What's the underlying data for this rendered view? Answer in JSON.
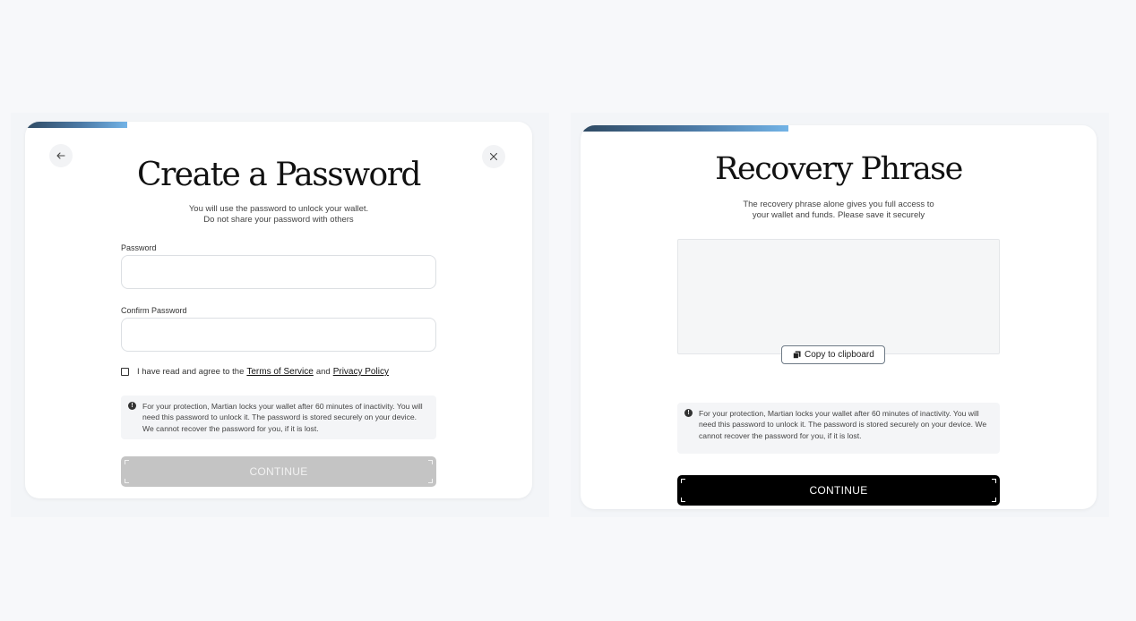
{
  "create_password": {
    "title": "Create a Password",
    "subtitle_line1": "You will use the password to unlock your wallet.",
    "subtitle_line2": "Do not share your password with others",
    "progress": 0.2,
    "password_label": "Password",
    "password_value": "",
    "confirm_label": "Confirm Password",
    "confirm_value": "",
    "agree_text": "I have read and agree to the",
    "terms_link": "Terms of Service",
    "and_text": "and",
    "privacy_link": "Privacy Policy",
    "info_text": "For your protection, Martian locks your wallet after 60 minutes of inactivity. You will need this password to unlock it. The password is stored securely on your device. We cannot recover the password for you, if it is lost.",
    "continue_label": "CONTINUE",
    "back_icon": "arrow-left-icon",
    "close_icon": "close-icon"
  },
  "recovery_phrase": {
    "title": "Recovery Phrase",
    "subtitle_line1": "The recovery phrase alone gives you full access to",
    "subtitle_line2": "your wallet and funds. Please save it securely",
    "progress": 0.4,
    "copy_label": "Copy to clipboard",
    "info_text": "For your protection, Martian locks your wallet after 60 minutes of inactivity. You will need this password to unlock it. The password is stored securely on your device. We cannot recover the password for you, if it is lost.",
    "continue_label": "CONTINUE"
  },
  "colors": {
    "accent_dark": "#2f4a63",
    "accent_light": "#72b3e6",
    "button_disabled": "#c4c4c4",
    "button_primary": "#000000"
  }
}
